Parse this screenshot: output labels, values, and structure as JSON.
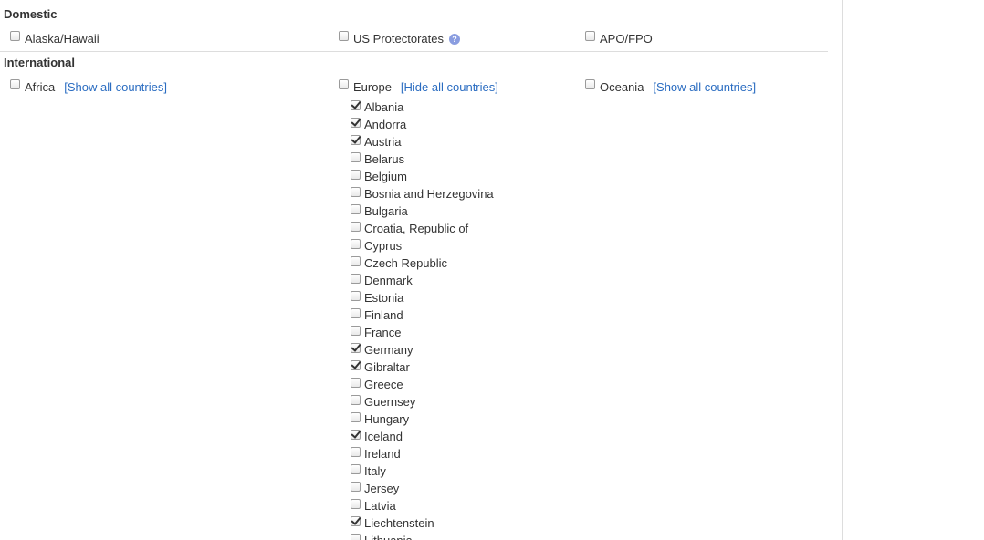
{
  "domestic": {
    "heading": "Domestic",
    "options": [
      {
        "label": "Alaska/Hawaii",
        "checked": false
      },
      {
        "label": "US Protectorates",
        "checked": false,
        "help_icon": "question-icon"
      },
      {
        "label": "APO/FPO",
        "checked": false
      }
    ]
  },
  "international": {
    "heading": "International",
    "regions": [
      {
        "label": "Africa",
        "checked": false,
        "toggle_label": "[Show all countries]"
      },
      {
        "label": "Europe",
        "checked": false,
        "toggle_label": "[Hide all countries]"
      },
      {
        "label": "Oceania",
        "checked": false,
        "toggle_label": "[Show all countries]"
      }
    ],
    "europe_countries": [
      {
        "name": "Albania",
        "checked": true
      },
      {
        "name": "Andorra",
        "checked": true
      },
      {
        "name": "Austria",
        "checked": true
      },
      {
        "name": "Belarus",
        "checked": false
      },
      {
        "name": "Belgium",
        "checked": false
      },
      {
        "name": "Bosnia and Herzegovina",
        "checked": false
      },
      {
        "name": "Bulgaria",
        "checked": false
      },
      {
        "name": "Croatia, Republic of",
        "checked": false
      },
      {
        "name": "Cyprus",
        "checked": false
      },
      {
        "name": "Czech Republic",
        "checked": false
      },
      {
        "name": "Denmark",
        "checked": false
      },
      {
        "name": "Estonia",
        "checked": false
      },
      {
        "name": "Finland",
        "checked": false
      },
      {
        "name": "France",
        "checked": false
      },
      {
        "name": "Germany",
        "checked": true
      },
      {
        "name": "Gibraltar",
        "checked": true
      },
      {
        "name": "Greece",
        "checked": false
      },
      {
        "name": "Guernsey",
        "checked": false
      },
      {
        "name": "Hungary",
        "checked": false
      },
      {
        "name": "Iceland",
        "checked": true
      },
      {
        "name": "Ireland",
        "checked": false
      },
      {
        "name": "Italy",
        "checked": false
      },
      {
        "name": "Jersey",
        "checked": false
      },
      {
        "name": "Latvia",
        "checked": false
      },
      {
        "name": "Liechtenstein",
        "checked": true
      },
      {
        "name": "Lithuania",
        "checked": false
      }
    ]
  },
  "colors": {
    "link": "#2a6cc1",
    "text": "#333333",
    "divider": "#dddddd",
    "help_icon": "#8a9de0"
  }
}
